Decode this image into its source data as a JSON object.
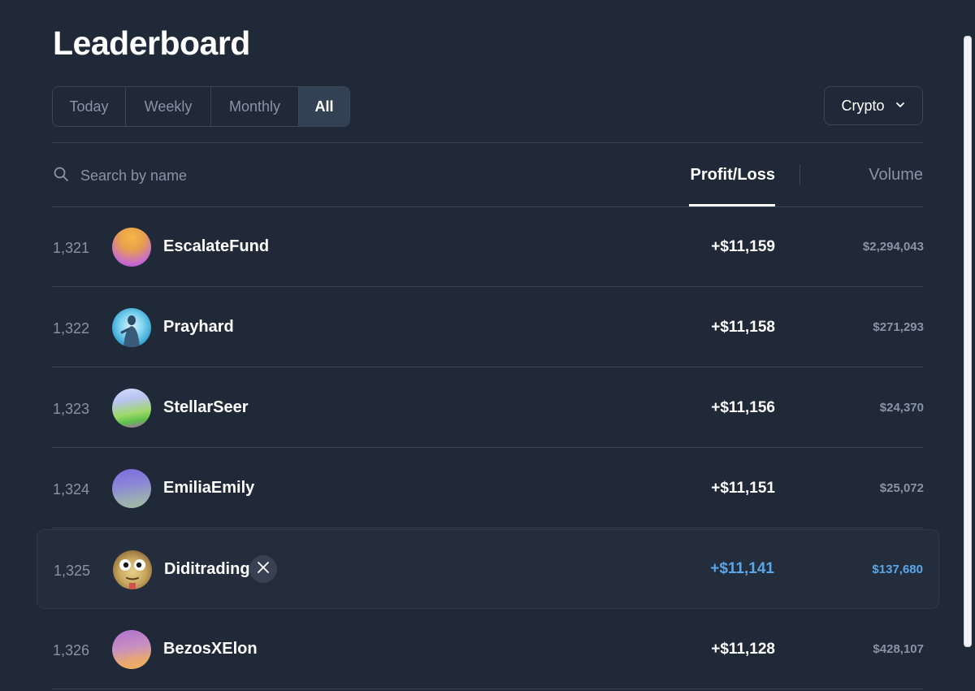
{
  "page": {
    "title": "Leaderboard"
  },
  "period_tabs": [
    {
      "label": "Today",
      "active": false
    },
    {
      "label": "Weekly",
      "active": false
    },
    {
      "label": "Monthly",
      "active": false
    },
    {
      "label": "All",
      "active": true
    }
  ],
  "category_select": {
    "value": "Crypto",
    "icon": "chevron-down-icon"
  },
  "search": {
    "placeholder": "Search by name",
    "value": "",
    "icon": "search-icon"
  },
  "sort_tabs": {
    "profit_loss": "Profit/Loss",
    "volume": "Volume",
    "active": "profit_loss"
  },
  "colors": {
    "background": "#1f2937",
    "highlight_accent": "#5aa6e8",
    "muted_text": "#8894a6"
  },
  "rows": [
    {
      "rank": "1,321",
      "name": "EscalateFund",
      "profit_loss": "+$11,159",
      "volume": "$2,294,043",
      "has_x_link": false,
      "highlighted": false
    },
    {
      "rank": "1,322",
      "name": "Prayhard",
      "profit_loss": "+$11,158",
      "volume": "$271,293",
      "has_x_link": false,
      "highlighted": false
    },
    {
      "rank": "1,323",
      "name": "StellarSeer",
      "profit_loss": "+$11,156",
      "volume": "$24,370",
      "has_x_link": false,
      "highlighted": false
    },
    {
      "rank": "1,324",
      "name": "EmiliaEmily",
      "profit_loss": "+$11,151",
      "volume": "$25,072",
      "has_x_link": false,
      "highlighted": false
    },
    {
      "rank": "1,325",
      "name": "Diditrading",
      "profit_loss": "+$11,141",
      "volume": "$137,680",
      "has_x_link": true,
      "highlighted": true
    },
    {
      "rank": "1,326",
      "name": "BezosXElon",
      "profit_loss": "+$11,128",
      "volume": "$428,107",
      "has_x_link": false,
      "highlighted": false
    }
  ]
}
